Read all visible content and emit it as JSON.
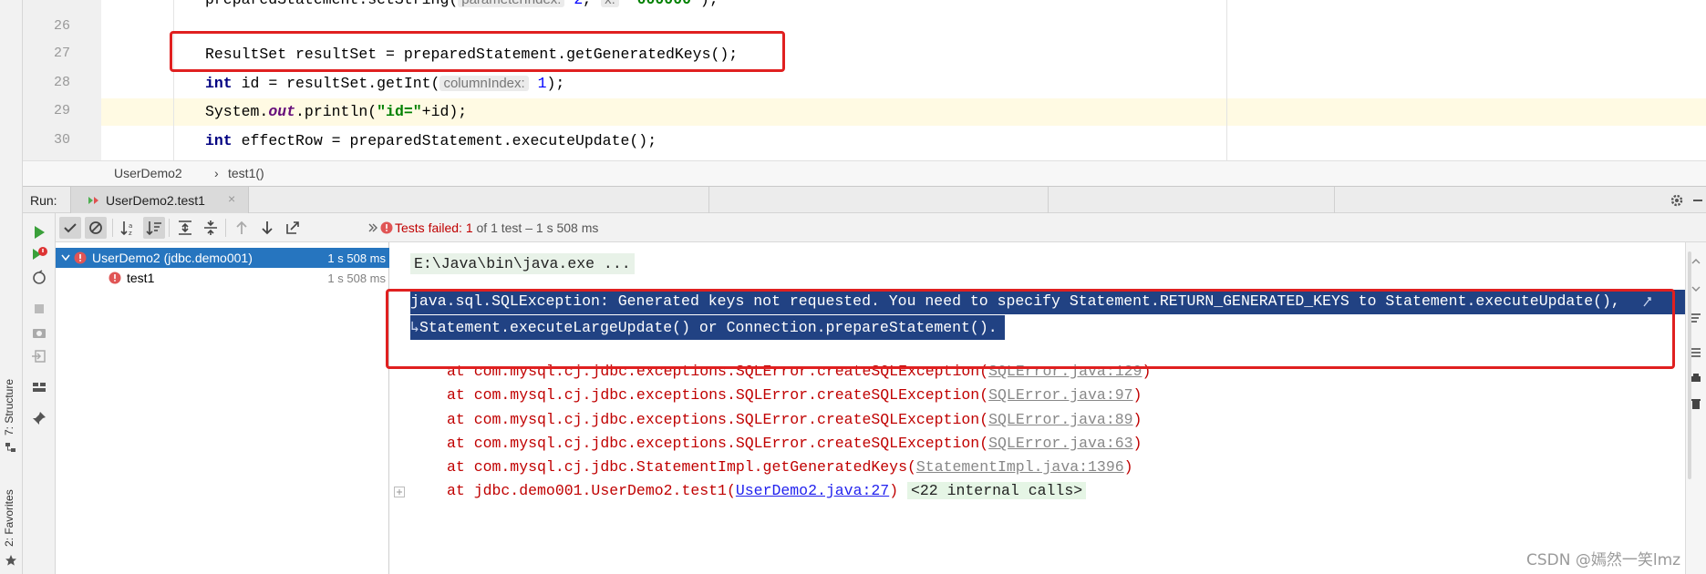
{
  "editor": {
    "line_numbers": [
      "26",
      "27",
      "28",
      "29",
      "30"
    ],
    "lines": {
      "l26": {
        "code_before": "preparedStatement.setString(",
        "hint": "parameterIndex:",
        "arg1": "2",
        "hint2": "x:",
        "arg2": "\"000000\"",
        "after": ");"
      },
      "l27": {
        "code": "ResultSet resultSet = preparedStatement.getGeneratedKeys();"
      },
      "l28": {
        "keyword": "int",
        "code": " id = resultSet.getInt(",
        "hint": "columnIndex:",
        "arg": "1",
        "after": ");"
      },
      "l29": {
        "prefix": "System.",
        "field": "out",
        "middle": ".println(",
        "string": "\"id=\"",
        "after": "+id);"
      },
      "l30": {
        "keyword": "int",
        "code": " effectRow = preparedStatement.executeUpdate();"
      }
    }
  },
  "breadcrumb": {
    "class_name": "UserDemo2",
    "separator": "›",
    "method": "test1()"
  },
  "run": {
    "label": "Run:",
    "tab_label": "UserDemo2.test1",
    "close_glyph": "×",
    "status": {
      "prefix": "Tests failed:",
      "failed": "1",
      "suffix": "of 1 test – 1 s 508 ms"
    },
    "tree": [
      {
        "label": "UserDemo2 (jdbc.demo001)",
        "time": "1 s 508 ms"
      },
      {
        "label": "test1",
        "time": "1 s 508 ms"
      }
    ],
    "console": {
      "command": "E:\\Java\\bin\\java.exe ...",
      "exception_line1": "java.sql.SQLException: Generated keys not requested. You need to specify Statement.RETURN_GENERATED_KEYS to Statement.executeUpdate(),",
      "exception_line2": "Statement.executeLargeUpdate() or Connection.prepareStatement().",
      "stack": [
        {
          "at": "at com.mysql.cj.jdbc.exceptions.SQLError.createSQLException(",
          "link": "SQLError.java:129",
          "end": ")"
        },
        {
          "at": "at com.mysql.cj.jdbc.exceptions.SQLError.createSQLException(",
          "link": "SQLError.java:97",
          "end": ")"
        },
        {
          "at": "at com.mysql.cj.jdbc.exceptions.SQLError.createSQLException(",
          "link": "SQLError.java:89",
          "end": ")"
        },
        {
          "at": "at com.mysql.cj.jdbc.exceptions.SQLError.createSQLException(",
          "link": "SQLError.java:63",
          "end": ")"
        },
        {
          "at": "at com.mysql.cj.jdbc.StatementImpl.getGeneratedKeys(",
          "link": "StatementImpl.java:1396",
          "end": ")"
        },
        {
          "at": "at jdbc.demo001.UserDemo2.test1(",
          "link": "UserDemo2.java:27",
          "end": ")",
          "internal": "<22 internal calls>"
        }
      ]
    }
  },
  "side_tabs": {
    "structure": "7: Structure",
    "favorites": "2: Favorites"
  },
  "watermark": "CSDN @嫣然一笑lmz",
  "colors": {
    "selection": "#2675bf",
    "error_red": "#c00000",
    "annotation_box": "#e02020",
    "console_selection": "#214283"
  }
}
